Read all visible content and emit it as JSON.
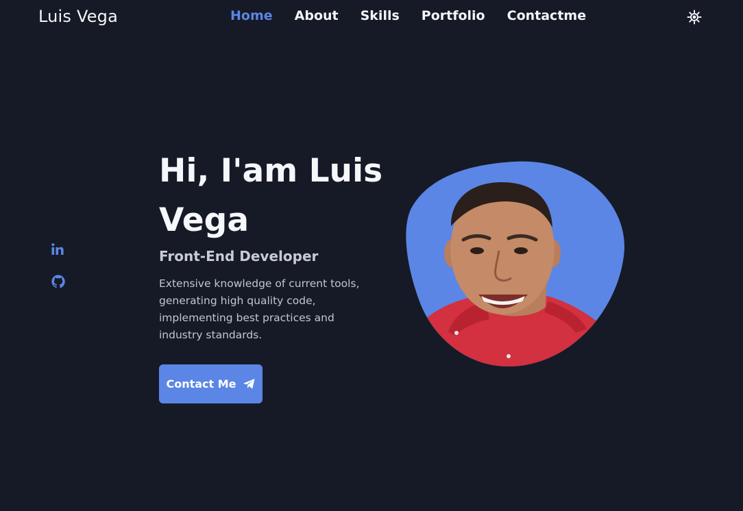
{
  "header": {
    "logo": "Luis Vega",
    "nav": [
      {
        "label": "Home",
        "active": true
      },
      {
        "label": "About",
        "active": false
      },
      {
        "label": "Skills",
        "active": false
      },
      {
        "label": "Portfolio",
        "active": false
      },
      {
        "label": "Contactme",
        "active": false
      }
    ],
    "theme_toggle_icon": "sun-icon"
  },
  "social": [
    {
      "icon": "linkedin-icon"
    },
    {
      "icon": "github-icon"
    }
  ],
  "hero": {
    "title": "Hi, I'am Luis Vega",
    "subtitle": "Front-End Developer",
    "description": "Extensive knowledge of current tools, generating high quality code, implementing best practices and industry standards.",
    "button_label": "Contact Me",
    "button_icon": "send-icon",
    "image_icon": "profile-photo"
  },
  "colors": {
    "background": "#161a27",
    "accent": "#5b86e5",
    "text": "#f4f5f8",
    "muted": "#c3c6cf"
  }
}
